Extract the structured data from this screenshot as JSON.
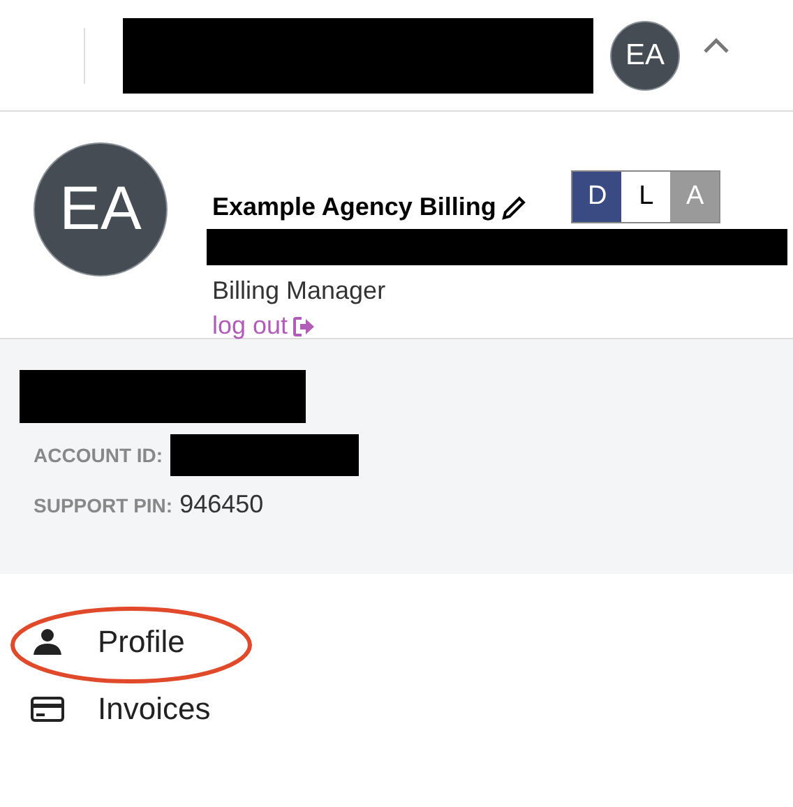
{
  "header": {
    "avatar_initials": "EA"
  },
  "profile": {
    "avatar_initials": "EA",
    "name": "Example Agency Billing",
    "role": "Billing Manager",
    "logout": "log out",
    "modes": [
      {
        "label": "D",
        "color": "#3a4a82"
      },
      {
        "label": "L",
        "color": "#ffffff"
      },
      {
        "label": "A",
        "color": "#9a9a9a"
      }
    ]
  },
  "account": {
    "fields": [
      {
        "label": "ACCOUNT ID:",
        "kind": "redacted"
      },
      {
        "label": "SUPPORT PIN:",
        "kind": "text",
        "value": "946450"
      }
    ]
  },
  "menu": [
    {
      "label": "Profile",
      "kind": "person",
      "circled": true
    },
    {
      "label": "Invoices",
      "kind": "card",
      "circled": false
    }
  ]
}
